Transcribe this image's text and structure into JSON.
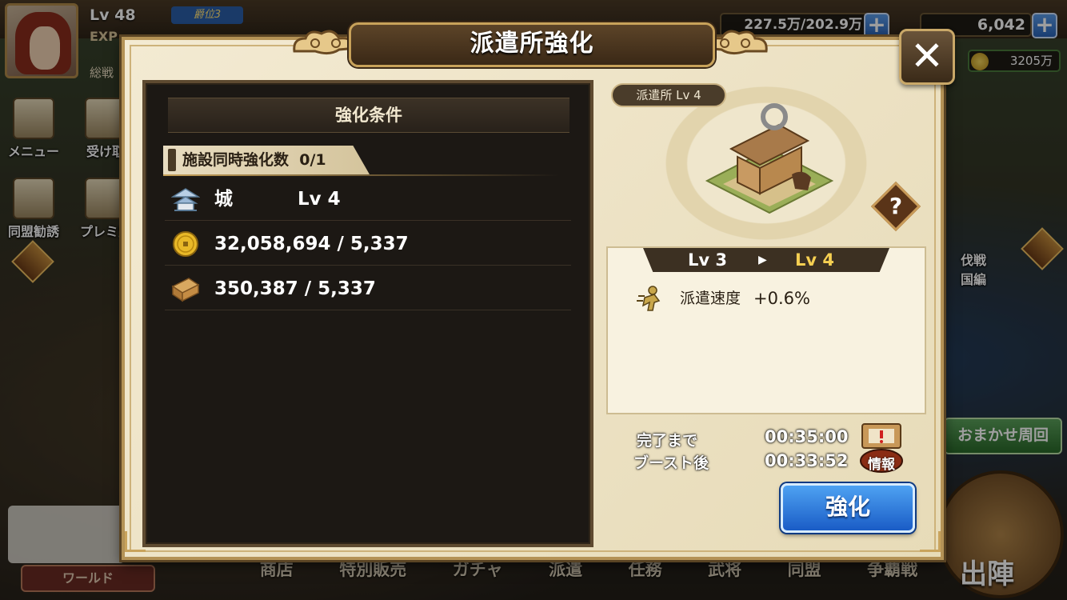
{
  "hud": {
    "level": "Lv 48",
    "rank": "爵位3",
    "exp_label": "EXP",
    "sohei_label": "総戦",
    "troops": "227.5万/202.9万",
    "gems": "6,042",
    "gold": "3205万"
  },
  "side_left": {
    "menu": "メニュー",
    "receive": "受け取",
    "alliance_invite": "同盟勧誘",
    "premium": "プレミ宝"
  },
  "side_right": {
    "battle": "伐戦",
    "kingdom": "国編",
    "auto_lap": "おまかせ周回",
    "sortie": "出陣"
  },
  "world_button": "ワールド",
  "bottom_nav": [
    "商店",
    "特別販売",
    "ガチャ",
    "派遣",
    "任務",
    "武将",
    "同盟",
    "争覇戦"
  ],
  "dialog": {
    "title": "派遣所強化",
    "close_symbol": "✕",
    "conditions": {
      "header": "強化条件",
      "simultaneous_label": "施設同時強化数",
      "simultaneous_value": "0/1",
      "rows": [
        {
          "icon": "castle-icon",
          "name": "城",
          "value": "Lv 4"
        },
        {
          "icon": "gold-coin-icon",
          "name": "",
          "value": "32,058,694 / 5,337"
        },
        {
          "icon": "wood-icon",
          "name": "",
          "value": "350,387 / 5,337"
        }
      ]
    },
    "building": {
      "badge": "派遣所 Lv 4",
      "help": "?"
    },
    "level_change": {
      "from": "Lv 3",
      "arrow": "▶",
      "to": "Lv 4"
    },
    "effect": {
      "label": "派遣速度",
      "value": "+0.6%"
    },
    "time": {
      "complete_label": "完了まで",
      "complete_value": "00:35:00",
      "boost_label": "ブースト後",
      "boost_value": "00:33:52"
    },
    "info_button": "情報",
    "upgrade_button": "強化"
  },
  "colors": {
    "upgrade_blue": "#2a72dc",
    "title_brown": "#4a3620",
    "level_gold": "#f6cf52"
  }
}
